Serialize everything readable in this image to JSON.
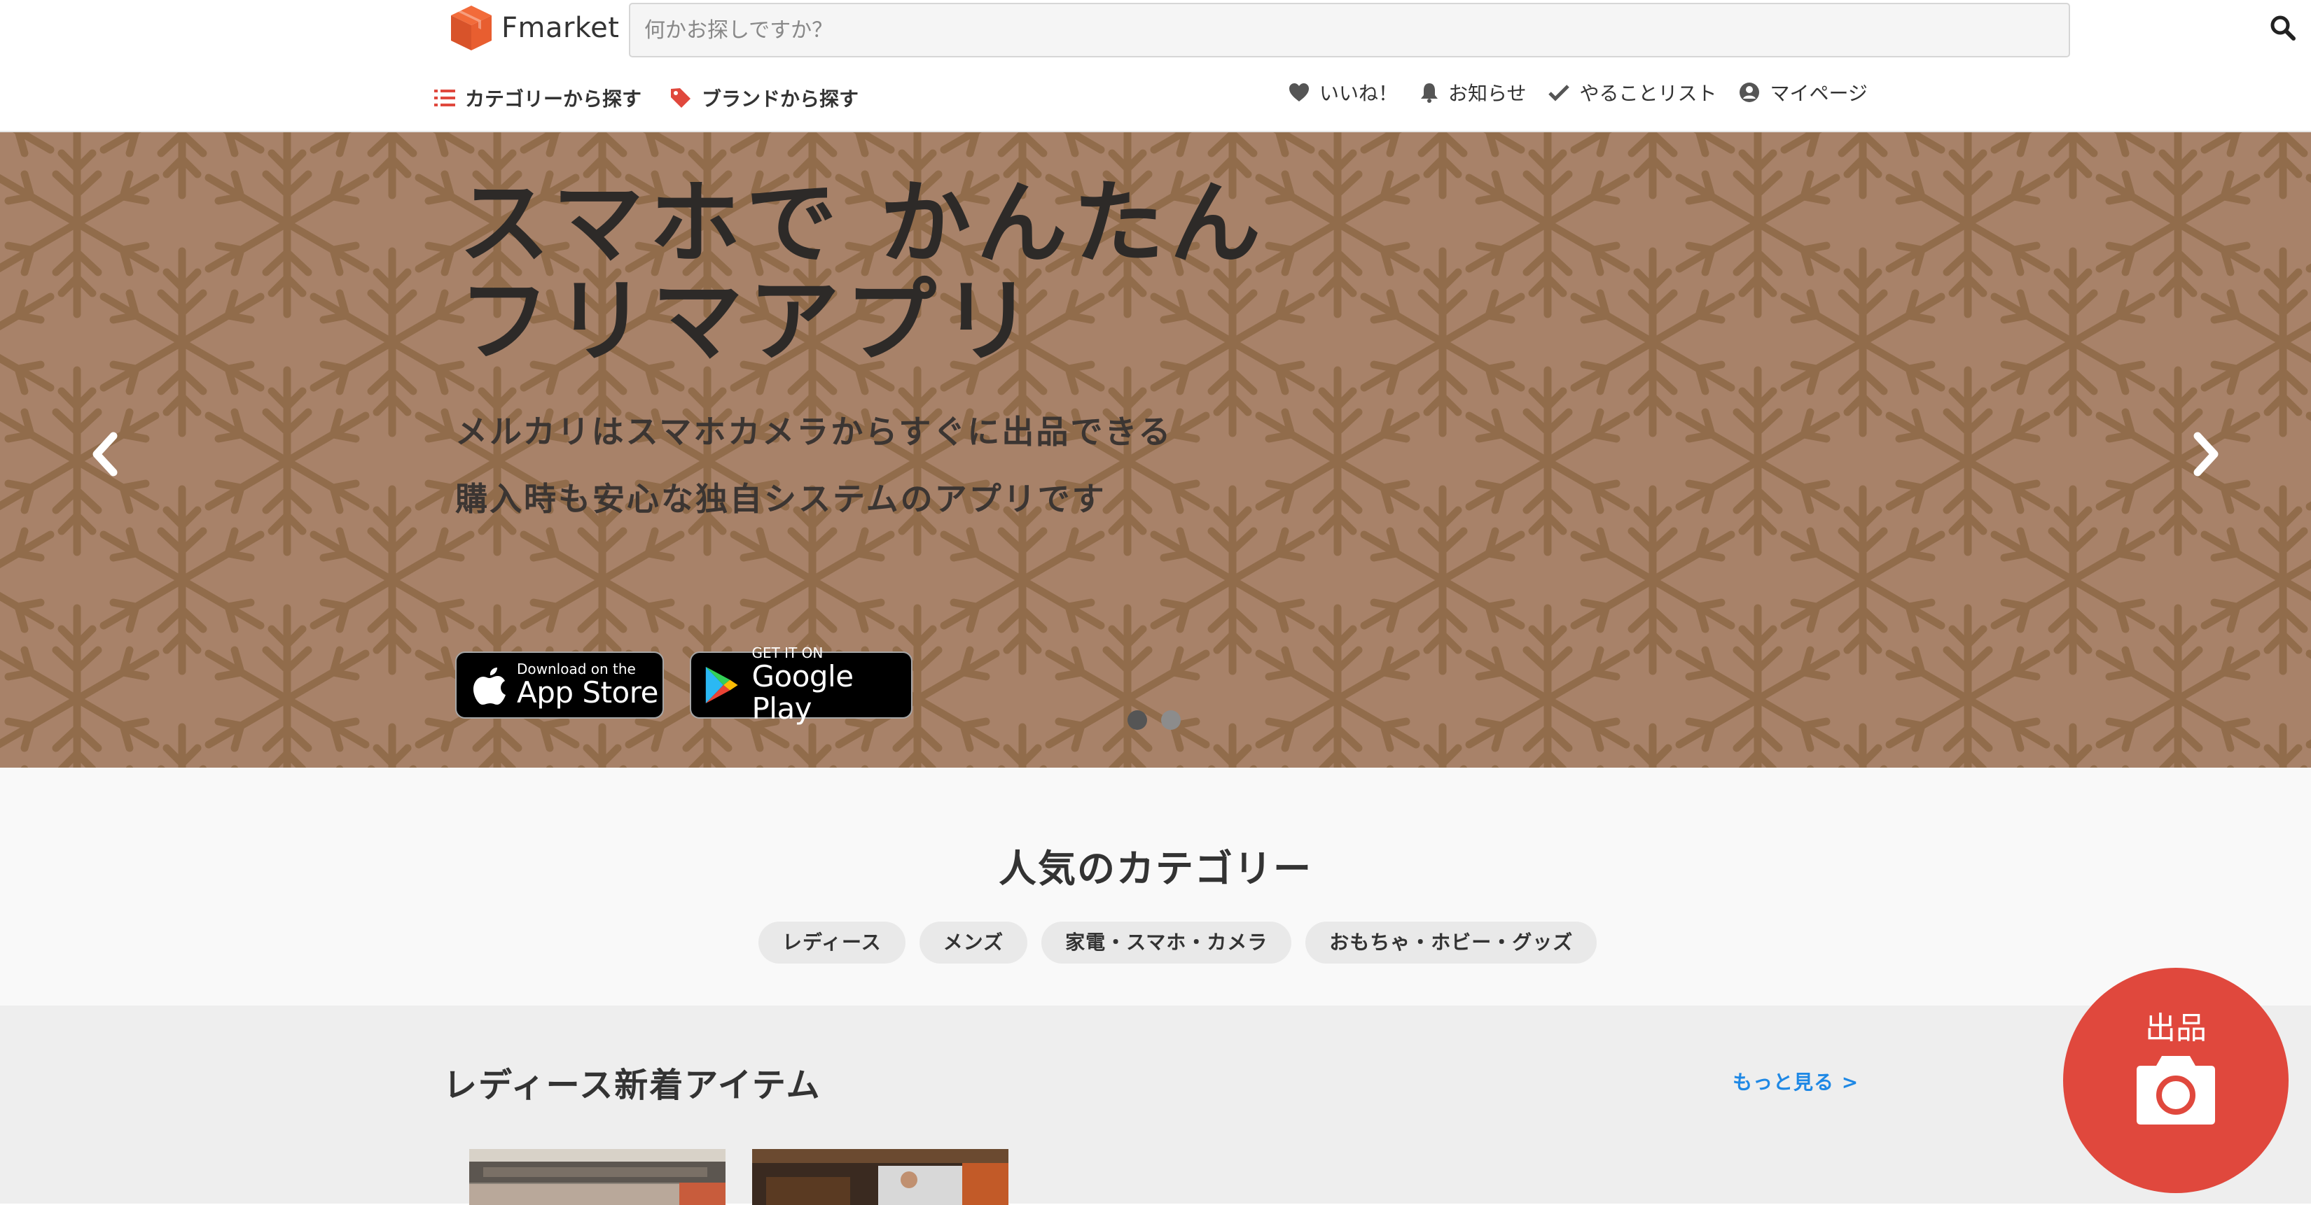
{
  "header": {
    "logo_text": "Fmarket",
    "search": {
      "placeholder": "何かお探しですか？",
      "value": ""
    },
    "nav_left": [
      {
        "label": "カテゴリーから探す",
        "icon": "list-icon"
      },
      {
        "label": "ブランドから探す",
        "icon": "tag-icon"
      }
    ],
    "nav_right": [
      {
        "label": "いいね！",
        "icon": "heart-icon"
      },
      {
        "label": "お知らせ",
        "icon": "bell-icon"
      },
      {
        "label": "やることリスト",
        "icon": "check-icon"
      },
      {
        "label": "マイページ",
        "icon": "user-icon"
      }
    ]
  },
  "hero": {
    "title_line1": "スマホで かんたん",
    "title_line2": "フリマアプリ",
    "sub_line1": "メルカリはスマホカメラからすぐに出品できる",
    "sub_line2": "購入時も安心な独自システムのアプリです",
    "app_store": {
      "small": "Download on the",
      "big": "App Store"
    },
    "google_play": {
      "small": "GET IT ON",
      "big": "Google Play"
    },
    "slides": 2,
    "active_slide": 1,
    "background_color": "#a88269",
    "pattern_color": "#8e6a48"
  },
  "popular": {
    "title": "人気のカテゴリー",
    "categories": [
      "レディース",
      "メンズ",
      "家電・スマホ・カメラ",
      "おもちゃ・ホビー・グッズ"
    ]
  },
  "new_items": {
    "title": "レディース新着アイテム",
    "more_label": "もっと見る >"
  },
  "sell_button": {
    "label": "出品",
    "color": "#e0483d",
    "icon": "camera-icon"
  },
  "colors": {
    "accent": "#e0483d",
    "link": "#1e88e5",
    "text": "#333333"
  }
}
